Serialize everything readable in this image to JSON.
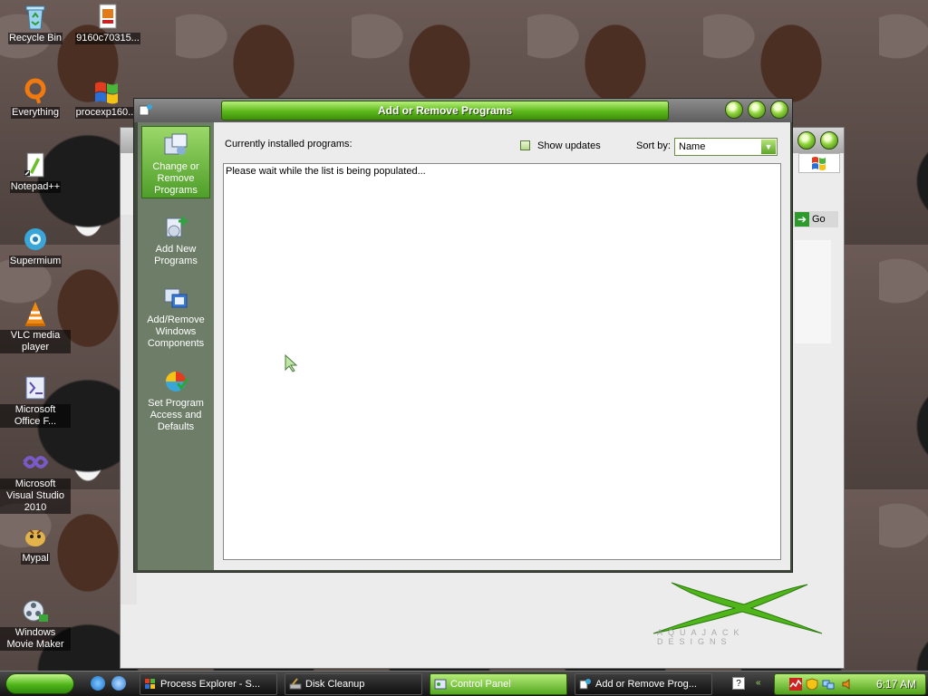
{
  "desktop": {
    "icons": [
      {
        "label": "Recycle Bin"
      },
      {
        "label": "9160c70315..."
      },
      {
        "label": "Everything"
      },
      {
        "label": "procexp160..."
      },
      {
        "label": "Notepad++"
      },
      {
        "label": "Supermium"
      },
      {
        "label": "VLC media player"
      },
      {
        "label": "Microsoft Office F..."
      },
      {
        "label": "Microsoft Visual Studio 2010"
      },
      {
        "label": "Mypal"
      },
      {
        "label": "Windows Movie Maker"
      }
    ]
  },
  "control_panel": {
    "go_label": "Go",
    "logo_text": "AQUAJACK DESIGNS"
  },
  "arp": {
    "title": "Add or Remove Programs",
    "sidebar": [
      {
        "label": "Change or Remove Programs",
        "selected": true
      },
      {
        "label": "Add New Programs"
      },
      {
        "label": "Add/Remove Windows Components"
      },
      {
        "label": "Set Program Access and Defaults"
      }
    ],
    "installed_label": "Currently installed programs:",
    "show_updates_label": "Show updates",
    "sort_by_label": "Sort by:",
    "sort_value": "Name",
    "loading_text": "Please wait while the list is being populated..."
  },
  "taskbar": {
    "tasks": [
      {
        "label": "Process Explorer - S..."
      },
      {
        "label": "Disk Cleanup"
      },
      {
        "label": "Control Panel",
        "active": true
      },
      {
        "label": "Add or Remove Prog..."
      }
    ],
    "help_label": "?",
    "clock": "6:17 AM"
  },
  "colors": {
    "accent_green": "#5cb81a",
    "sidebar_bg": "#6e7d68"
  }
}
